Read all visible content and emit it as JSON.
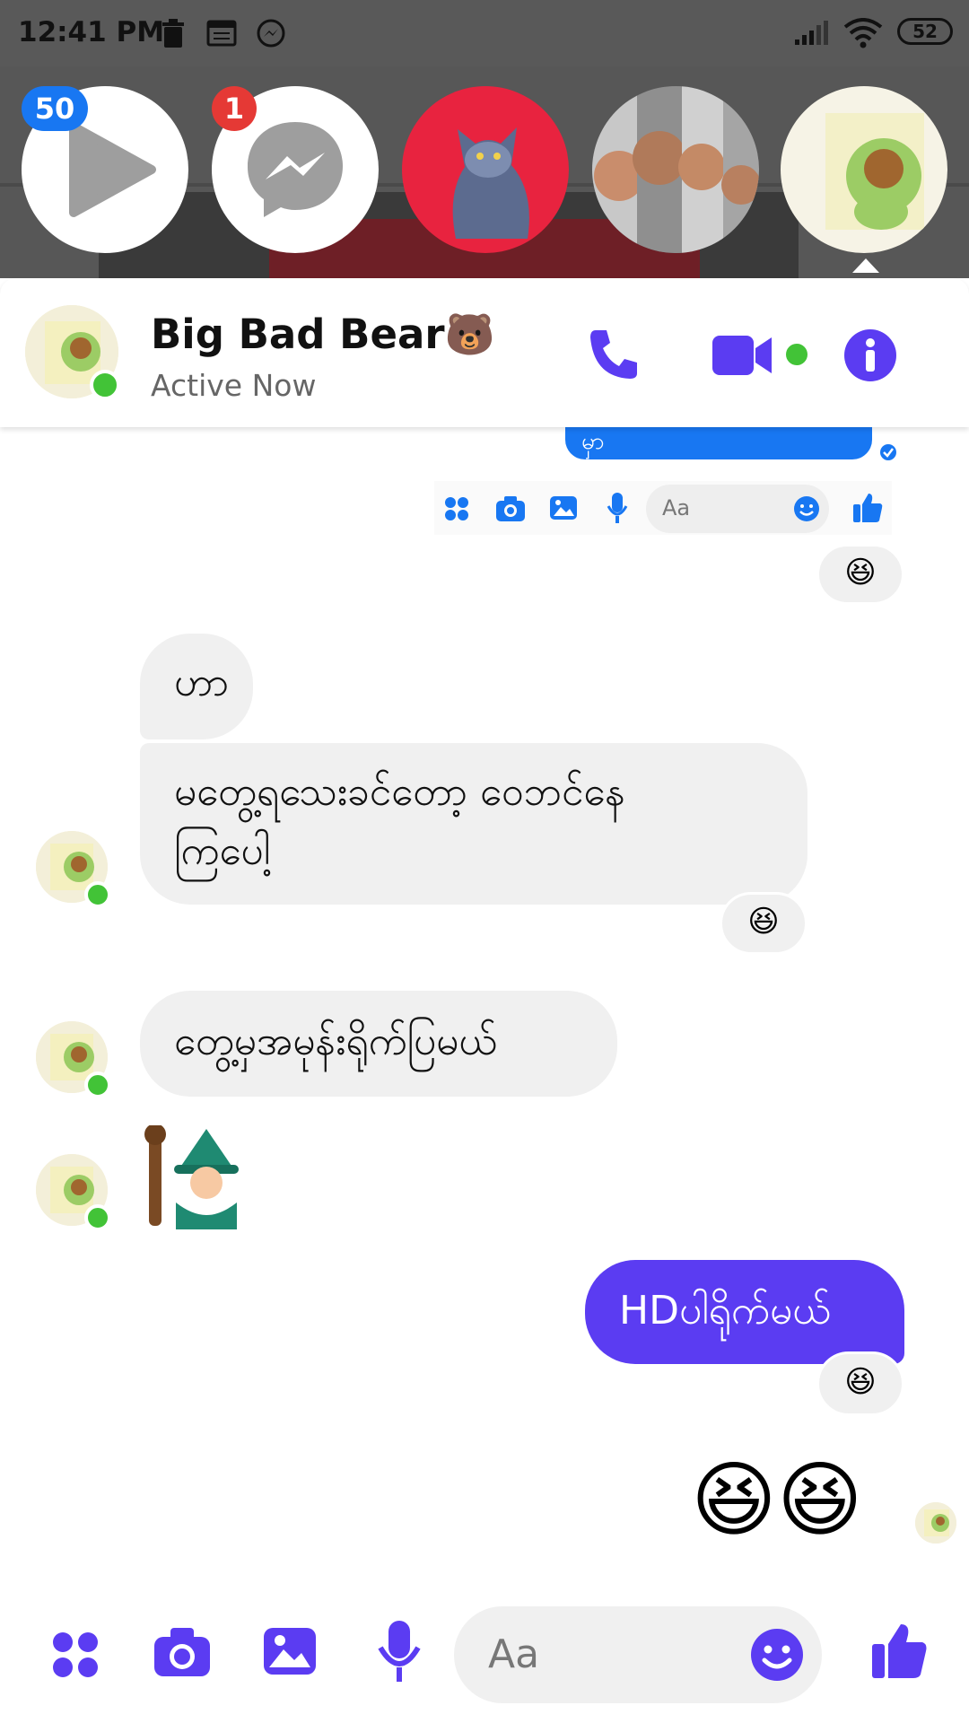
{
  "status_bar": {
    "time": "12:41 PM",
    "battery": "52"
  },
  "chat_heads": {
    "video_badge": "50",
    "messenger_badge": "1"
  },
  "header": {
    "name": "Big Bad Bear🐻",
    "status": "Active Now"
  },
  "embedded_composer": {
    "placeholder": "Aa",
    "message_fragment": "မှာ"
  },
  "messages": [
    {
      "from": "contact",
      "text": "ဟာ"
    },
    {
      "from": "contact",
      "text_line1": "မတွေ့ရသေးခင်တော့ ဝေဘင်နေ",
      "text_line2": "ကြပေါ့"
    },
    {
      "from": "contact",
      "text": "တွေ့မှအမုန်းရိုက်ပြမယ်"
    },
    {
      "from": "contact",
      "sticker": "wizard-sticker"
    },
    {
      "from": "me",
      "text": "HDပါရိုက်မယ်"
    },
    {
      "from": "me",
      "emoji": "😆😆"
    }
  ],
  "reaction_emoji": "😆",
  "composer": {
    "placeholder": "Aa"
  },
  "colors": {
    "accent": "#5b3cf2",
    "online": "#42c337",
    "bubble_in": "#f0f0f0",
    "badge_red": "#e53935",
    "badge_blue": "#1877f2"
  },
  "icons": [
    "apps-icon",
    "camera-icon",
    "gallery-icon",
    "mic-icon",
    "emoji-icon",
    "like-icon",
    "phone-icon",
    "video-call-icon",
    "info-icon",
    "play-icon",
    "messenger-icon",
    "trash-icon",
    "calendar-icon",
    "wifi-icon",
    "signal-icon"
  ]
}
